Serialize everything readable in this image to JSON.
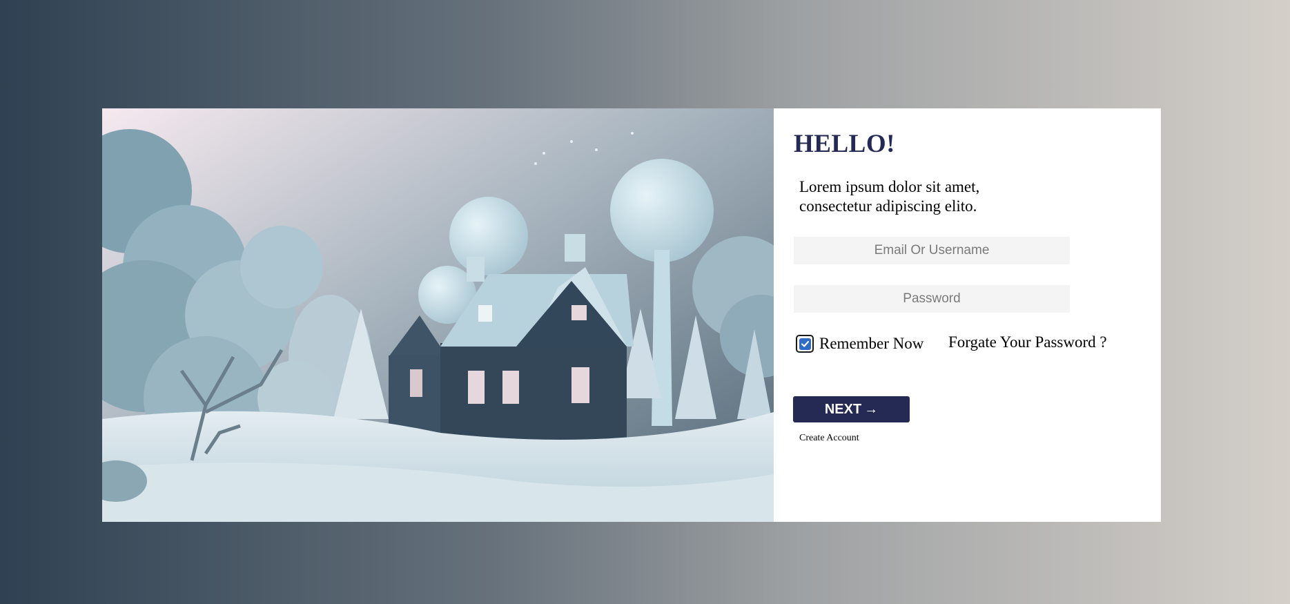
{
  "login": {
    "title": "HELLO!",
    "subtitle": "Lorem ipsum dolor sit amet, consectetur adipiscing elito.",
    "email_placeholder": "Email Or Username",
    "password_placeholder": "Password",
    "remember_label": "Remember Now",
    "remember_checked": true,
    "forgot_label": "Forgate Your Password ?",
    "next_label": "NEXT",
    "next_arrow": "→",
    "create_account_label": "Create Account"
  },
  "hero": {
    "icon": "winter-cottage-illustration"
  },
  "colors": {
    "accent": "#252a55",
    "checkbox": "#2f6cc6",
    "field_bg": "#f4f4f4",
    "bg_left": "#2f4152",
    "bg_right": "#d4cfc9"
  }
}
